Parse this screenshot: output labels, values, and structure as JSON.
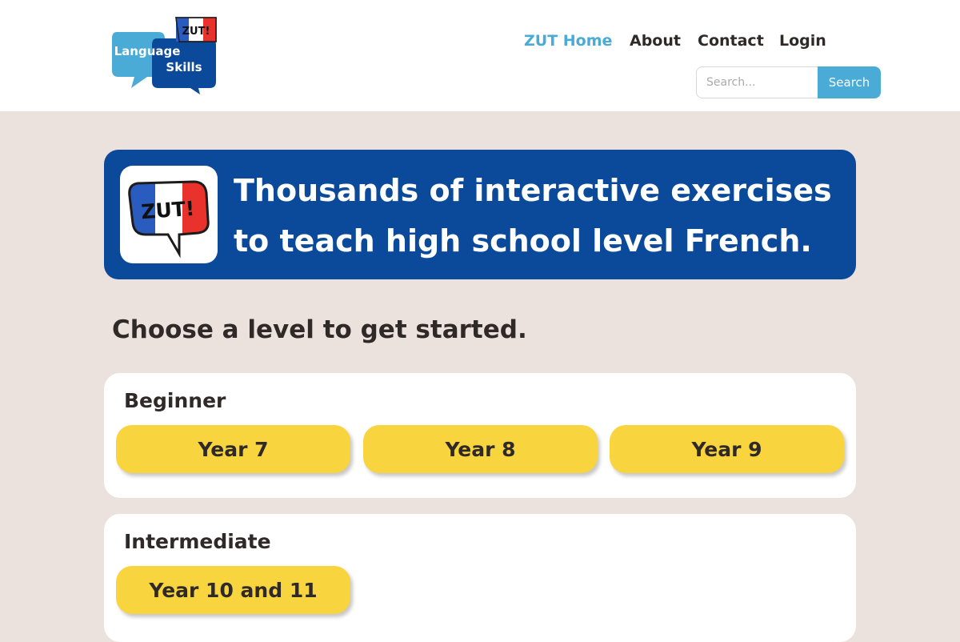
{
  "logo": {
    "badge_text": "ZUT!",
    "line1": "Language",
    "line2": "Skills"
  },
  "nav": {
    "items": [
      "ZUT Home",
      "About",
      "Contact",
      "Login"
    ]
  },
  "search": {
    "placeholder": "Search...",
    "button_label": "Search"
  },
  "hero": {
    "icon_text": "ZUT!",
    "line1": "Thousands of interactive exercises",
    "line2": "to teach high school level French."
  },
  "prompt": "Choose a level to get started.",
  "levels": [
    {
      "title": "Beginner",
      "buttons": [
        "Year 7",
        "Year 8",
        "Year 9"
      ]
    },
    {
      "title": "Intermediate",
      "buttons": [
        "Year 10 and 11"
      ]
    }
  ],
  "colors": {
    "accent_blue": "#4aabd6",
    "hero_blue": "#0b4a9a",
    "button_yellow": "#f8d43f",
    "page_bg": "#ece2dd",
    "flag_red": "#e8322b"
  }
}
